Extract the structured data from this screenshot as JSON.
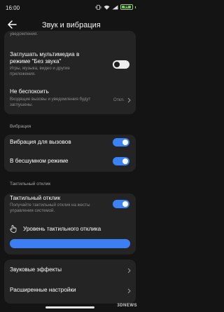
{
  "status": {
    "time": "16:00",
    "battery": "84"
  },
  "header": {
    "title": "Звук и вибрация"
  },
  "top_card": {
    "partial_text": "уведомления.",
    "mute_media": {
      "label_line1": "Заглушать мультимедиа в",
      "label_line2": "режиме \"Без звука\"",
      "desc_line1": "Игры, музыка, видео и другие",
      "desc_line2": "приложения.",
      "state": "off"
    },
    "dnd": {
      "label": "Не беспокоить",
      "desc_line1": "Входящие вызовы и уведомления будут",
      "desc_line2": "заглушены.",
      "value": "Откл."
    }
  },
  "vibration_section": {
    "title": "Вибрация",
    "items": [
      {
        "label": "Вибрация для вызовов",
        "state": "on"
      },
      {
        "label": "В бесшумном режиме",
        "state": "on"
      }
    ]
  },
  "haptic_section": {
    "title": "Тактильный отклик",
    "haptic": {
      "label": "Тактильный отклик",
      "desc_line1": "Получайте тактильный отклик на жесты",
      "desc_line2": "управления системой.",
      "state": "on"
    },
    "level_label": "Уровень тактильного отклика"
  },
  "bottom_card": {
    "sound_effects": "Звуковые эффекты",
    "advanced": "Расширенные настройки"
  },
  "watermark": "3DNEWS"
}
